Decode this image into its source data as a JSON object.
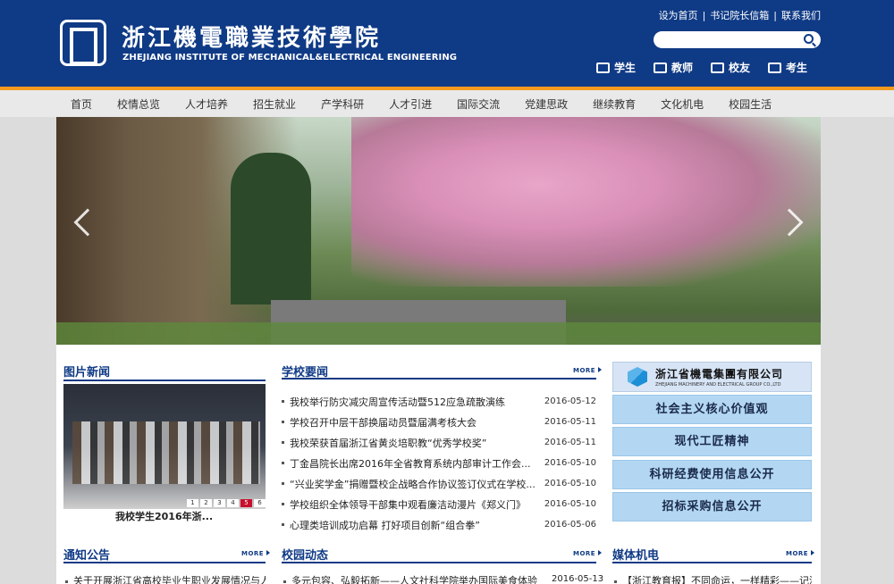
{
  "header": {
    "logo_cn": "浙江機電職業技術學院",
    "logo_en": "ZHEJIANG INSTITUTE OF MECHANICAL&ELECTRICAL ENGINEERING",
    "top_links": [
      "设为首页",
      "书记院长信箱",
      "联系我们"
    ],
    "search_placeholder": "",
    "audience": [
      "学生",
      "教师",
      "校友",
      "考生"
    ]
  },
  "nav": [
    "首页",
    "校情总览",
    "人才培养",
    "招生就业",
    "产学科研",
    "人才引进",
    "国际交流",
    "党建思政",
    "继续教育",
    "文化机电",
    "校园生活"
  ],
  "sections": {
    "photo_news": {
      "title": "图片新闻",
      "caption": "我校学生2016年浙...",
      "slide_dots": [
        "1",
        "2",
        "3",
        "4",
        "5",
        "6"
      ]
    },
    "school_news": {
      "title": "学校要闻",
      "more": "MORE",
      "items": [
        {
          "title": "我校举行防灾减灾周宣传活动暨512应急疏散演练",
          "date": "2016-05-12"
        },
        {
          "title": "学校召开中层干部换届动员暨届满考核大会",
          "date": "2016-05-11"
        },
        {
          "title": "我校荣获首届浙江省黄炎培职教“优秀学校奖”",
          "date": "2016-05-11"
        },
        {
          "title": "丁金昌院长出席2016年全省教育系统内部审计工作会...",
          "date": "2016-05-10"
        },
        {
          "title": "“兴业奖学金”捐赠暨校企战略合作协议签订仪式在学校...",
          "date": "2016-05-10"
        },
        {
          "title": "学校组织全体领导干部集中观看廉洁动漫片《郑义门》",
          "date": "2016-05-10"
        },
        {
          "title": "心理类培训成功启幕 打好项目创新“组合拳”",
          "date": "2016-05-06"
        }
      ]
    },
    "group": {
      "name_cn": "浙江省機電集團有限公司",
      "name_en": "ZHEJIANG MACHINERY AND ELECTRICAL GROUP CO.,LTD",
      "buttons": [
        "社会主义核心价值观",
        "现代工匠精神",
        "科研经费使用信息公开",
        "招标采购信息公开"
      ]
    },
    "notices": {
      "title": "通知公告",
      "more": "MORE",
      "first_item": "关于开展浙江省高校毕业生职业发展情况与人..."
    },
    "campus_news": {
      "title": "校园动态",
      "more": "MORE",
      "first_item": {
        "title": "多元包容、弘毅拓新——人文社科学院举办国际美食体验...",
        "date": "2016-05-13"
      }
    },
    "media": {
      "title": "媒体机电",
      "more": "MORE",
      "first_item": "【浙江教育报】不同命运，一样精彩——记浙..."
    }
  },
  "colors": {
    "header_blue": "#0f3a85",
    "accent_orange": "#f39a1e",
    "side_button": "#b3d7f2"
  }
}
